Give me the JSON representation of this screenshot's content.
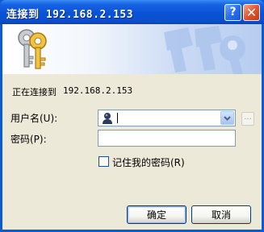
{
  "window": {
    "title": "连接到 192.168.2.153",
    "help_label": "?",
    "close_label": "✕",
    "accent": "#0a53d6",
    "close_color": "#e2542f"
  },
  "content": {
    "connecting_label": "正在连接到",
    "connecting_host": "192.168.2.153"
  },
  "form": {
    "username_label": "用户名(U):",
    "username_value": "",
    "password_label": "密码(P):",
    "password_value": "",
    "remember_label": "记住我的密码(R)",
    "remember_checked": false,
    "browse_label": "..."
  },
  "buttons": {
    "ok_label": "确定",
    "cancel_label": "取消"
  },
  "icons": {
    "banner": "keys-icon",
    "user": "user-icon",
    "dropdown": "chevron-down-icon"
  }
}
